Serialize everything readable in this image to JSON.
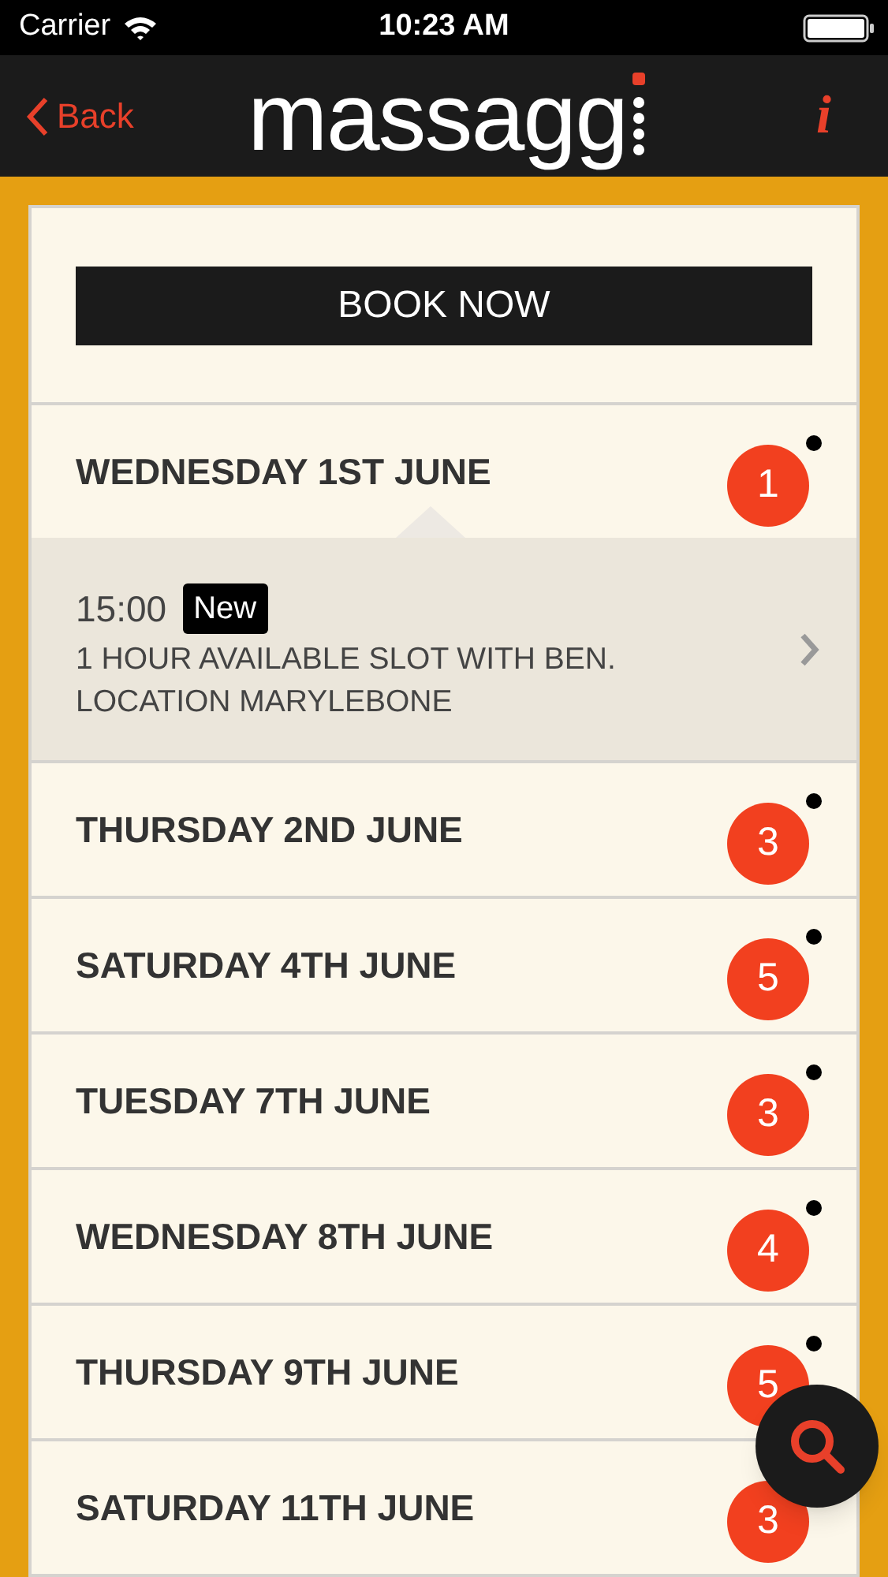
{
  "status_bar": {
    "carrier": "Carrier",
    "time": "10:23 AM"
  },
  "nav": {
    "back": "Back",
    "logo": "massagg",
    "info": "i"
  },
  "book_button": "BOOK NOW",
  "days": [
    {
      "label": "WEDNESDAY 1ST JUNE",
      "count": "1",
      "unread": true,
      "slots": [
        {
          "time": "15:00",
          "badge": "New",
          "description": "1 HOUR AVAILABLE SLOT WITH BEN.\nLOCATION MARYLEBONE"
        }
      ]
    },
    {
      "label": "THURSDAY 2ND JUNE",
      "count": "3",
      "unread": true
    },
    {
      "label": "SATURDAY 4TH JUNE",
      "count": "5",
      "unread": true
    },
    {
      "label": "TUESDAY 7TH JUNE",
      "count": "3",
      "unread": true
    },
    {
      "label": "WEDNESDAY 8TH JUNE",
      "count": "4",
      "unread": true
    },
    {
      "label": "THURSDAY 9TH JUNE",
      "count": "5",
      "unread": true
    },
    {
      "label": "SATURDAY 11TH JUNE",
      "count": "3"
    }
  ]
}
